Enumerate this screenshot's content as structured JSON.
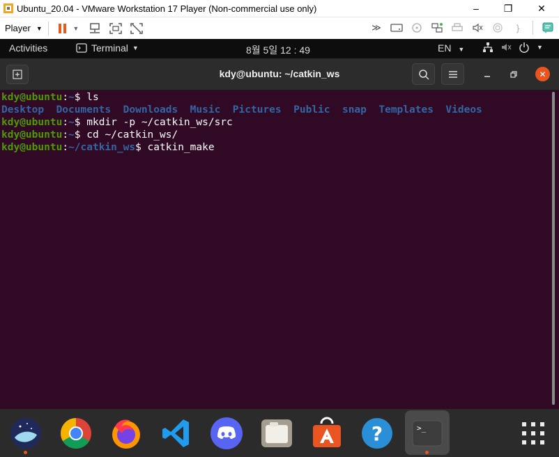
{
  "vm_window": {
    "title": "Ubuntu_20.04 - VMware Workstation 17 Player (Non-commercial use only)",
    "minimize": "–",
    "maximize": "❐",
    "close": "✕"
  },
  "vm_toolbar": {
    "player_label": "Player"
  },
  "gnome_panel": {
    "activities": "Activities",
    "app_menu": "Terminal",
    "clock": "8월 5일 12 : 49",
    "language": "EN"
  },
  "terminal": {
    "title": "kdy@ubuntu: ~/catkin_ws",
    "prompt_user": "kdy@ubuntu",
    "lines": [
      {
        "path": "~",
        "command": "ls"
      },
      {
        "dirs": [
          "Desktop",
          "Documents",
          "Downloads",
          "Music",
          "Pictures",
          "Public",
          "snap",
          "Templates",
          "Videos"
        ]
      },
      {
        "path": "~",
        "command": "mkdir -p ~/catkin_ws/src"
      },
      {
        "path": "~",
        "command": "cd ~/catkin_ws/"
      },
      {
        "path": "~/catkin_ws",
        "command": "catkin_make"
      }
    ]
  },
  "dock": {
    "items": [
      "kde-connect-icon",
      "chrome-icon",
      "firefox-icon",
      "vscode-icon",
      "discord-icon",
      "files-icon",
      "software-center-icon",
      "help-icon",
      "terminal-icon",
      "show-apps-icon"
    ],
    "terminal_prompt_glyph": ">_"
  }
}
